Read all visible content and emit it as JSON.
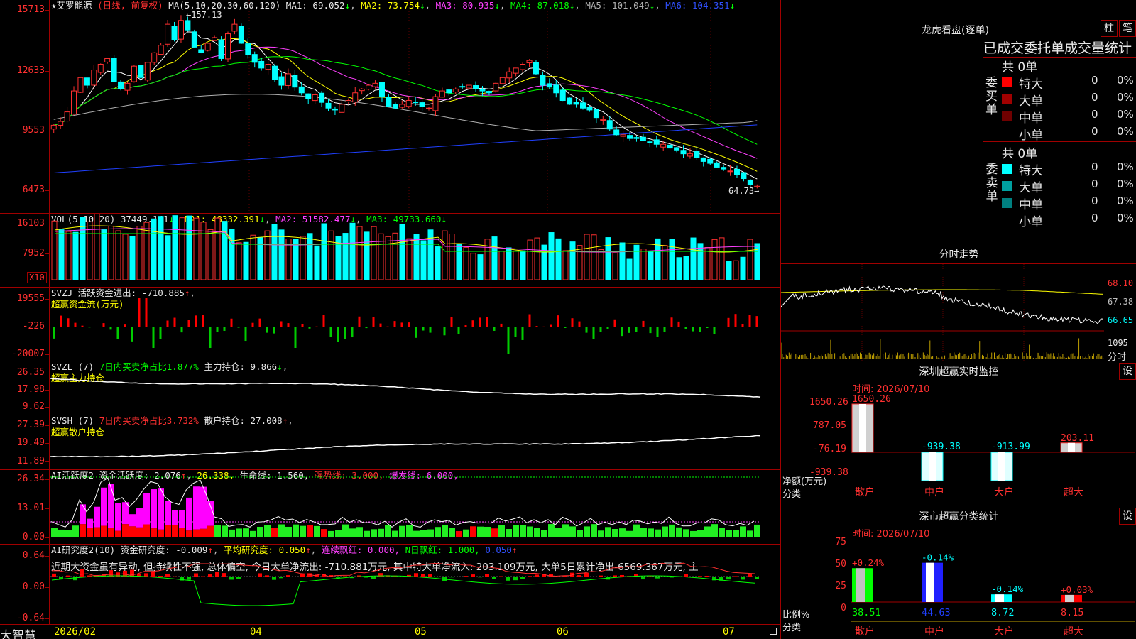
{
  "stock": {
    "name": "艾罗能源",
    "mode": "(日线, 前复权)",
    "ma_header": "MA(5,10,20,30,60,120)",
    "ma1": "MA1: 69.052",
    "ma2": "MA2: 73.754",
    "ma3": "MA3: 80.935",
    "ma4": "MA4: 87.018",
    "ma5": "MA5: 101.049",
    "ma6": "MA6: 104.351",
    "high_note": "157.13",
    "low_note": "64.73",
    "yticks": [
      "15713",
      "12633",
      "9553",
      "6473"
    ]
  },
  "volume": {
    "header": "VOL(5,10,20)",
    "vol": "37449.141",
    "ma1": "MA1: 48332.391",
    "ma2": "MA2: 51582.477",
    "ma3": "MA3: 49733.660",
    "yticks": [
      "16103",
      "7952"
    ],
    "unit": "X10"
  },
  "svzj": {
    "header": "SVZJ",
    "label": "活跃资金进出: -710.885",
    "subtitle": "超赢资金流(万元)",
    "yticks": [
      "19555",
      "-226",
      "-20007"
    ]
  },
  "svzl": {
    "header": "SVZL (7)",
    "ratio": "7日内买卖净占比1.877%",
    "hold": "主力持仓: 9.866",
    "subtitle": "超赢主力持仓",
    "yticks": [
      "26.35",
      "17.98",
      "9.62"
    ]
  },
  "svsh": {
    "header": "SVSH (7)",
    "ratio": "7日内买卖净占比3.732%",
    "hold": "散户持仓: 27.008",
    "subtitle": "超赢散户持仓",
    "yticks": [
      "27.39",
      "19.49",
      "11.89"
    ]
  },
  "ai_active": {
    "header": "AI活跃度2",
    "active": "资金活跃度: 2.076",
    "v2": "26.338,",
    "life": "生命线: 1.560,",
    "strong": "强势线: 3.000,",
    "burst": "爆发线: 6.000,",
    "yticks": [
      "26.34",
      "13.01",
      "0.00"
    ]
  },
  "ai_research": {
    "header": "AI研究度2(10)",
    "research": "资金研究度: -0.009",
    "avg": "平均研究度: 0.050",
    "lianxu": "连续飘红: 0.000,",
    "nri": "N日飘红: 1.000,",
    "tail": "0.050",
    "comment": "近期大资金虽有异动, 但持续性不强, 总体偏空, 今日大单净流出: -710.881万元, 其中特大单净流入: 203.109万元, 大单5日累计净出-6569.367万元, 主",
    "yticks": [
      "0.64",
      "0.00",
      "-0.64"
    ]
  },
  "xaxis": {
    "labels": [
      "2026/02",
      "04",
      "05",
      "06",
      "07"
    ]
  },
  "brand": "大智慧",
  "lhb": {
    "title": "龙虎看盘(逐单)",
    "btn_zhu": "柱",
    "btn_bi": "笔",
    "table_title": "已成交委托单成交量统计",
    "buy_label": "委买单",
    "sell_label": "委卖单",
    "buy_total": "共 0单",
    "sell_total": "共 0单",
    "buy_rows": [
      {
        "cat": "特大",
        "v1": "0",
        "v2": "0%",
        "color": "#ff0000"
      },
      {
        "cat": "大单",
        "v1": "0",
        "v2": "0%",
        "color": "#a00000"
      },
      {
        "cat": "中单",
        "v1": "0",
        "v2": "0%",
        "color": "#700000"
      },
      {
        "cat": "小单",
        "v1": "0",
        "v2": "0%",
        "color": ""
      }
    ],
    "sell_rows": [
      {
        "cat": "特大",
        "v1": "0",
        "v2": "0%",
        "color": "#00ffff"
      },
      {
        "cat": "大单",
        "v1": "0",
        "v2": "0%",
        "color": "#00a0a0"
      },
      {
        "cat": "中单",
        "v1": "0",
        "v2": "0%",
        "color": "#008080"
      },
      {
        "cat": "小单",
        "v1": "0",
        "v2": "0%",
        "color": ""
      }
    ]
  },
  "intraday": {
    "title": "分时走势",
    "prices": [
      "68.10",
      "67.38",
      "66.65"
    ],
    "vol_lbl": "1095",
    "vol_unit": "分时"
  },
  "monitor": {
    "title": "深圳超赢实时监控",
    "btn": "设",
    "time": "时间: 2026/07/10",
    "yticks": [
      "1650.26",
      "787.05",
      "-76.19",
      "-939.38"
    ],
    "ylabel": "净额(万元)",
    "xlabel": "分类",
    "bars": [
      {
        "cat": "散户",
        "value": 1650.26,
        "label": "1650.26"
      },
      {
        "cat": "中户",
        "value": -939.38,
        "label": "-939.38"
      },
      {
        "cat": "大户",
        "value": -913.99,
        "label": "-913.99"
      },
      {
        "cat": "超大",
        "value": 203.11,
        "label": "203.11"
      }
    ]
  },
  "classify": {
    "title": "深市超赢分类统计",
    "btn": "设",
    "time": "时间: 2026/07/10",
    "yticks": [
      "75",
      "50",
      "25",
      "0"
    ],
    "ylabel": "比例%",
    "xlabel": "分类",
    "bars": [
      {
        "cat": "散户",
        "value": 38.51,
        "label": "38.51",
        "chg": "+0.24%"
      },
      {
        "cat": "中户",
        "value": 44.63,
        "label": "44.63",
        "chg": "-0.14%"
      },
      {
        "cat": "大户",
        "value": 8.72,
        "label": "8.72",
        "chg": "-0.14%"
      },
      {
        "cat": "超大",
        "value": 8.15,
        "label": "8.15",
        "chg": "+0.03%"
      }
    ]
  },
  "chart_data": [
    {
      "type": "candlestick",
      "title": "艾罗能源 (日线, 前复权)",
      "ylim": [
        6473,
        15713
      ],
      "x_range": [
        "2026/02",
        "2026/07/10"
      ],
      "high": 157.13,
      "low": 64.73,
      "close_series": [
        97,
        99,
        104,
        115,
        122,
        118,
        126,
        129,
        132,
        120,
        116,
        119,
        128,
        122,
        130,
        135,
        139,
        150,
        142,
        152,
        147,
        138,
        135,
        140,
        143,
        132,
        145,
        150,
        140,
        134,
        130,
        127,
        129,
        121,
        118,
        124,
        117,
        114,
        111,
        113,
        109,
        106,
        105,
        108,
        110,
        114,
        116,
        118,
        119,
        112,
        107,
        106,
        108,
        110,
        109,
        107,
        106,
        112,
        115,
        114,
        116,
        117,
        118,
        116,
        115,
        114,
        119,
        122,
        125,
        127,
        129,
        131,
        124,
        118,
        117,
        114,
        110,
        108,
        108,
        106,
        105,
        101,
        100,
        95,
        92,
        92,
        90,
        90,
        89,
        88,
        87,
        87,
        85,
        84,
        82,
        82,
        80,
        78,
        77,
        75,
        74,
        73,
        71,
        69,
        66,
        65
      ],
      "ma_lines": [
        "MA1",
        "MA2",
        "MA3",
        "MA4",
        "MA5",
        "MA6"
      ]
    },
    {
      "type": "bar",
      "title": "VOL(5,10,20)",
      "ylim": [
        0,
        16103
      ]
    },
    {
      "type": "bar",
      "title": "超赢资金流(万元)",
      "ylim": [
        -20007,
        19555
      ]
    },
    {
      "type": "bar",
      "title": "深圳超赢实时监控",
      "categories": [
        "散户",
        "中户",
        "大户",
        "超大"
      ],
      "values": [
        1650.26,
        -939.38,
        -913.99,
        203.11
      ],
      "ylabel": "净额(万元)",
      "xlabel": "分类"
    },
    {
      "type": "bar",
      "title": "深市超赢分类统计",
      "categories": [
        "散户",
        "中户",
        "大户",
        "超大"
      ],
      "values": [
        38.51,
        44.63,
        8.72,
        8.15
      ],
      "ylim": [
        0,
        75
      ],
      "ylabel": "比例%",
      "xlabel": "分类"
    }
  ],
  "colors": {
    "up": "#ff3030",
    "down": "#00ffff",
    "grid": "#a00000",
    "ma1": "#ffffff",
    "ma2": "#ffff00",
    "ma3": "#ff40ff",
    "ma4": "#00ff00",
    "ma5": "#b0b0b0",
    "ma6": "#2040ff"
  }
}
